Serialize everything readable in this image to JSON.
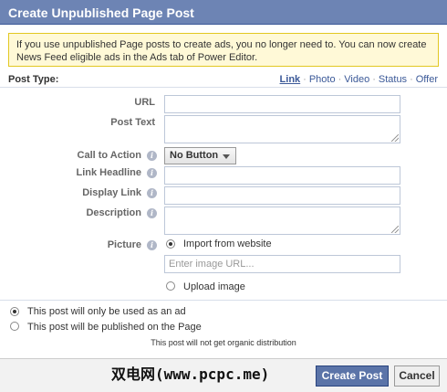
{
  "dialog": {
    "title": "Create Unpublished Page Post"
  },
  "notice": {
    "text": "If you use unpublished Page posts to create ads, you no longer need to. You can now create News Feed eligible ads in the Ads tab of Power Editor."
  },
  "post_type": {
    "label": "Post Type:",
    "options": [
      "Link",
      "Photo",
      "Video",
      "Status",
      "Offer"
    ],
    "selected": "Link",
    "separator": "·"
  },
  "form": {
    "url_label": "URL",
    "post_text_label": "Post Text",
    "cta_label": "Call to Action",
    "cta_value": "No Button",
    "link_headline_label": "Link Headline",
    "display_link_label": "Display Link",
    "description_label": "Description",
    "picture_label": "Picture",
    "picture_import_label": "Import from website",
    "image_url_placeholder": "Enter image URL...",
    "upload_label": "Upload image"
  },
  "distribution": {
    "ad_only_label": "This post will only be used as an ad",
    "published_label": "This post will be published on the Page",
    "note": "This post will not get organic distribution",
    "selected": "ad_only"
  },
  "footer": {
    "create_label": "Create Post",
    "cancel_label": "Cancel",
    "watermark": "双电网(www.pcpc.me)"
  },
  "colors": {
    "header": "#6d84b4",
    "link": "#3b5998",
    "notice_bg": "#fff9d7",
    "primary_button": "#5b74a8"
  }
}
